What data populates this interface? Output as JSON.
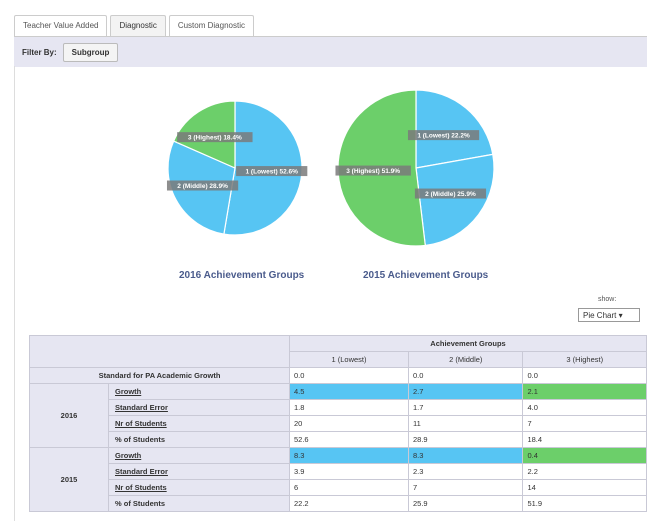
{
  "tabs": [
    "Teacher Value Added",
    "Diagnostic",
    "Custom Diagnostic"
  ],
  "filter": {
    "label": "Filter By:",
    "button": "Subgroup"
  },
  "colors": {
    "lowest": "#57c5f3",
    "middle": "#57c5f3",
    "highest": "#6ccf6a"
  },
  "chart_data": [
    {
      "type": "pie",
      "title": "2016 Achievement Groups",
      "slices": [
        {
          "label": "1 (Lowest) 52.6%",
          "value": 52.6
        },
        {
          "label": "2 (Middle) 28.9%",
          "value": 28.9
        },
        {
          "label": "3 (Highest) 18.4%",
          "value": 18.4
        }
      ]
    },
    {
      "type": "pie",
      "title": "2015 Achievement Groups",
      "slices": [
        {
          "label": "1 (Lowest) 22.2%",
          "value": 22.2
        },
        {
          "label": "2 (Middle) 25.9%",
          "value": 25.9
        },
        {
          "label": "3 (Highest) 51.9%",
          "value": 51.9
        }
      ]
    }
  ],
  "show": {
    "label": "show:",
    "value": "Pie Chart ▾"
  },
  "table": {
    "group_header": "Achievement Groups",
    "columns": [
      "1 (Lowest)",
      "2 (Middle)",
      "3 (Highest)"
    ],
    "standard_label": "Standard for PA Academic Growth",
    "standard_values": [
      "0.0",
      "0.0",
      "0.0"
    ],
    "years": [
      {
        "year": "2016",
        "rows": [
          {
            "label": "Growth",
            "values": [
              "4.5",
              "2.7",
              "2.1"
            ]
          },
          {
            "label": "Standard Error",
            "values": [
              "1.8",
              "1.7",
              "4.0"
            ]
          },
          {
            "label": "Nr of Students",
            "values": [
              "20",
              "11",
              "7"
            ]
          },
          {
            "label": "% of Students",
            "values": [
              "52.6",
              "28.9",
              "18.4"
            ]
          }
        ]
      },
      {
        "year": "2015",
        "rows": [
          {
            "label": "Growth",
            "values": [
              "8.3",
              "8.3",
              "0.4"
            ]
          },
          {
            "label": "Standard Error",
            "values": [
              "3.9",
              "2.3",
              "2.2"
            ]
          },
          {
            "label": "Nr of Students",
            "values": [
              "6",
              "7",
              "14"
            ]
          },
          {
            "label": "% of Students",
            "values": [
              "22.2",
              "25.9",
              "51.9"
            ]
          }
        ]
      }
    ]
  }
}
